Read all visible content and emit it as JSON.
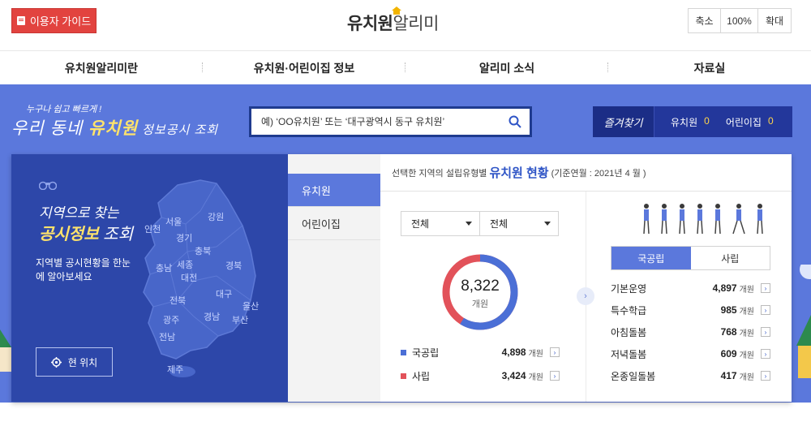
{
  "header": {
    "guide_label": "이용자 가이드",
    "logo_bold": "유치원",
    "logo_light": "알리미",
    "zoom": {
      "shrink": "축소",
      "level": "100%",
      "enlarge": "확대"
    }
  },
  "nav": [
    {
      "label": "유치원알리미란"
    },
    {
      "label": "유치원·어린이집 정보"
    },
    {
      "label": "알리미 소식"
    },
    {
      "label": "자료실"
    }
  ],
  "hero": {
    "tag_small": "누구나 쉽고 빠르게 !",
    "tag_a": "우리 동네 ",
    "tag_b": "유치원",
    "tag_c": " 정보공시 조회",
    "search_placeholder": "예) ‘OO유치원’ 또는 ‘대구광역시 동구 유치원’",
    "favorites": {
      "title": "즐겨찾기",
      "kinder_label": "유치원",
      "kinder_count": "0",
      "daycare_label": "어린이집",
      "daycare_count": "0"
    }
  },
  "map": {
    "title1": "지역으로 찾는",
    "title2_a": "공시정보",
    "title2_b": " 조회",
    "subtitle": "지역별 공시현황을 한눈에 알아보세요",
    "location_button": "현 위치",
    "regions": [
      "서울",
      "인천",
      "경기",
      "강원",
      "충북",
      "충남",
      "세종",
      "대전",
      "경북",
      "전북",
      "대구",
      "울산",
      "광주",
      "경남",
      "부산",
      "전남",
      "제주"
    ]
  },
  "tabs": [
    {
      "label": "유치원"
    },
    {
      "label": "어린이집"
    }
  ],
  "stats": {
    "header_a": "선택한 지역의 설립유형별",
    "header_hl": "유치원 현황",
    "header_ref": "(기준연월 : 2021년 4 월 )",
    "select1": "전체",
    "select2": "전체",
    "total": "8,322",
    "total_unit": "개원",
    "public_fraction": 0.5886,
    "legend": [
      {
        "label": "국공립",
        "value": "4,898",
        "unit": "개원",
        "color": "#4b6fd6"
      },
      {
        "label": "사립",
        "value": "3,424",
        "unit": "개원",
        "color": "#e2525a"
      }
    ],
    "segments": [
      "국공립",
      "사립"
    ],
    "services": [
      {
        "label": "기본운영",
        "value": "4,897",
        "unit": "개원"
      },
      {
        "label": "특수학급",
        "value": "985",
        "unit": "개원"
      },
      {
        "label": "아침돌봄",
        "value": "768",
        "unit": "개원"
      },
      {
        "label": "저녁돌봄",
        "value": "609",
        "unit": "개원"
      },
      {
        "label": "온종일돌봄",
        "value": "417",
        "unit": "개원"
      }
    ]
  }
}
